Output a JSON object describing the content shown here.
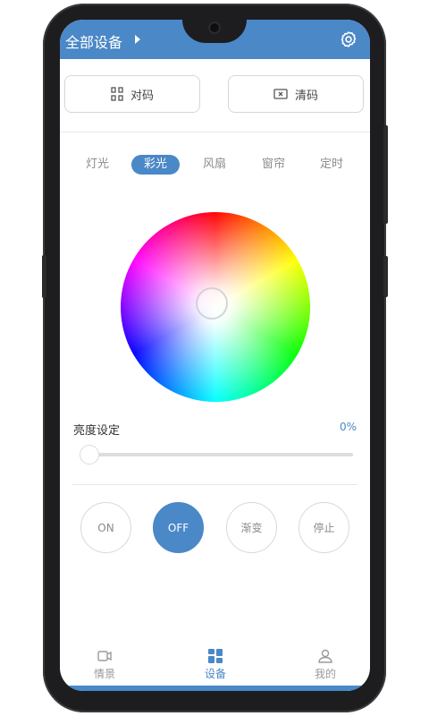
{
  "header": {
    "title": "全部设备",
    "accent": "#4a88c7"
  },
  "actions": {
    "pair_label": "对码",
    "clear_label": "清码"
  },
  "tabs": [
    {
      "label": "灯光",
      "active": false
    },
    {
      "label": "彩光",
      "active": true
    },
    {
      "label": "风扇",
      "active": false
    },
    {
      "label": "窗帘",
      "active": false
    },
    {
      "label": "定时",
      "active": false
    }
  ],
  "brightness": {
    "label": "亮度设定",
    "value_text": "0%",
    "level": 0
  },
  "controls": {
    "on_label": "ON",
    "off_label": "OFF",
    "fade_label": "渐变",
    "stop_label": "停止"
  },
  "nav": [
    {
      "label": "情景",
      "icon": "scene-icon",
      "active": false
    },
    {
      "label": "设备",
      "icon": "device-grid-icon",
      "active": true
    },
    {
      "label": "我的",
      "icon": "user-icon",
      "active": false
    }
  ]
}
